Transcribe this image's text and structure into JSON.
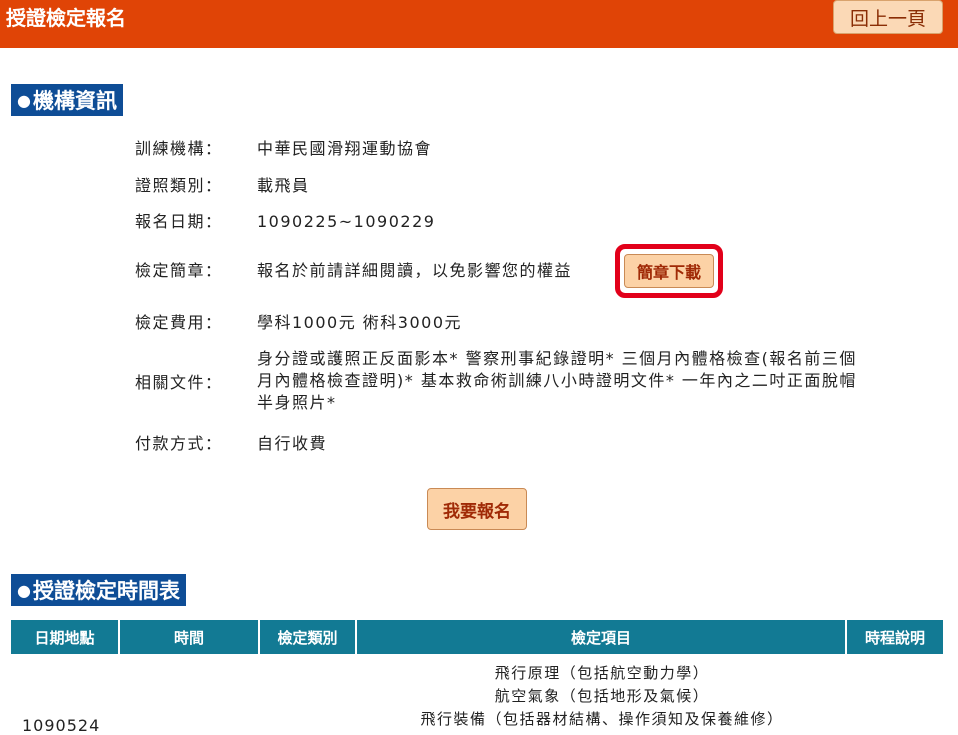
{
  "header": {
    "title": "授證檢定報名",
    "back_label": "回上一頁"
  },
  "sections": {
    "org_info_title": "機構資訊",
    "schedule_title": "授證檢定時間表"
  },
  "info": {
    "org": {
      "label": "訓練機構：",
      "value": "中華民國滑翔運動協會"
    },
    "license_type": {
      "label": "證照類別：",
      "value": "載飛員"
    },
    "signup_date": {
      "label": "報名日期：",
      "value": "1090225~1090229"
    },
    "rules": {
      "label": "檢定簡章：",
      "value": "報名於前請詳細閱讀，以免影響您的權益",
      "download_label": "簡章下載"
    },
    "fee": {
      "label": "檢定費用：",
      "value": "學科1000元 術科3000元"
    },
    "documents": {
      "label": "相關文件：",
      "lines": [
        "身分證或護照正反面影本* 警察刑事紀錄證明* 三個月內體格檢查(報名前三個",
        "月內體格檢查證明)* 基本救命術訓練八小時證明文件* 一年內之二吋正面脫帽",
        "半身照片*"
      ]
    },
    "payment": {
      "label": "付款方式：",
      "value": "自行收費"
    }
  },
  "register_label": "我要報名",
  "schedule": {
    "columns": [
      "日期地點",
      "時間",
      "檢定類別",
      "檢定項目",
      "時程說明"
    ],
    "rows": [
      {
        "date": "1090524",
        "items": [
          "飛行原理（包括航空動力學）",
          "航空氣象（包括地形及氣候）",
          "飛行裝備（包括器材結構、操作須知及保養維修）"
        ]
      }
    ]
  },
  "colors": {
    "topbar": "#e04406",
    "section_header": "#0e4d96",
    "table_header": "#127a94",
    "button_bg": "#fcd2a6",
    "highlight": "#e2001a"
  }
}
